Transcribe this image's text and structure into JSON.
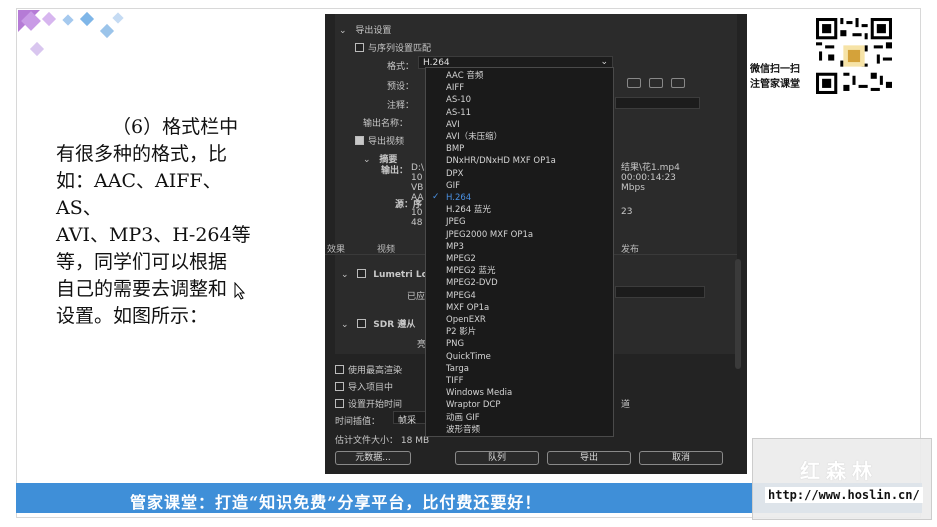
{
  "slide": {
    "paragraph_lines": [
      "（6）格式栏中",
      "有很多种的格式，比",
      "如：AAC、AIFF、AS、",
      "AVI、MP3、H-264等",
      "等，同学们可以根据",
      "自己的需要去调整和",
      "设置。如图所示："
    ],
    "qr_caption_lines": [
      "微信扫一扫",
      "注管家课堂"
    ],
    "banner_text": "管家课堂：打造“知识免费”分享平台，比付费还要好！",
    "watermark_logo": "红森林",
    "watermark_url": "http://www.hoslin.cn/"
  },
  "dialog": {
    "section_title": "导出设置",
    "match_sequence_label": "与序列设置匹配",
    "format_label": "格式：",
    "format_value": "H.264",
    "preset_label": "预设：",
    "comment_label": "注释：",
    "output_name_label": "输出名称：",
    "export_video_label": "导出视频",
    "summary_label": "摘要",
    "output_label": "输出：",
    "output_lines": [
      "D:\\",
      "10",
      "VB",
      "AA"
    ],
    "output_right_lines": [
      "结果\\花1.mp4",
      "00:00:14:23",
      "Mbps"
    ],
    "source_label": "源：序",
    "source_lines": [
      "10",
      "48"
    ],
    "source_right": "23",
    "tabs": [
      "效果",
      "视频",
      "发布"
    ],
    "lumetri_label": "Lumetri Lo",
    "applied_label": "已应",
    "sdr_label": "SDR 遵从",
    "sdr_sub": "亮",
    "use_max_render_label": "使用最高渲染",
    "import_project_label": "导入项目中",
    "set_start_time_label": "设置开始时间",
    "right_label": "道",
    "time_interp_label": "时间插值：",
    "time_interp_value": "帧采",
    "file_size_label": "估计文件大小：",
    "file_size_value": "18 MB",
    "buttons": {
      "metadata": "元数据...",
      "queue": "队列",
      "export": "导出",
      "cancel": "取消"
    }
  },
  "format_dropdown": {
    "items": [
      "AAC 音频",
      "AIFF",
      "AS-10",
      "AS-11",
      "AVI",
      "AVI（未压缩）",
      "BMP",
      "DNxHR/DNxHD MXF OP1a",
      "DPX",
      "GIF",
      "H.264",
      "H.264 蓝光",
      "JPEG",
      "JPEG2000 MXF OP1a",
      "MP3",
      "MPEG2",
      "MPEG2 蓝光",
      "MPEG2-DVD",
      "MPEG4",
      "MXF OP1a",
      "OpenEXR",
      "P2 影片",
      "PNG",
      "QuickTime",
      "Targa",
      "TIFF",
      "Windows Media",
      "Wraptor DCP",
      "动画 GIF",
      "波形音频"
    ],
    "selected": "H.264"
  },
  "colors": {
    "banner": "#3f8fd8",
    "dialog_bg": "#232323",
    "selected": "#4a90e2"
  }
}
